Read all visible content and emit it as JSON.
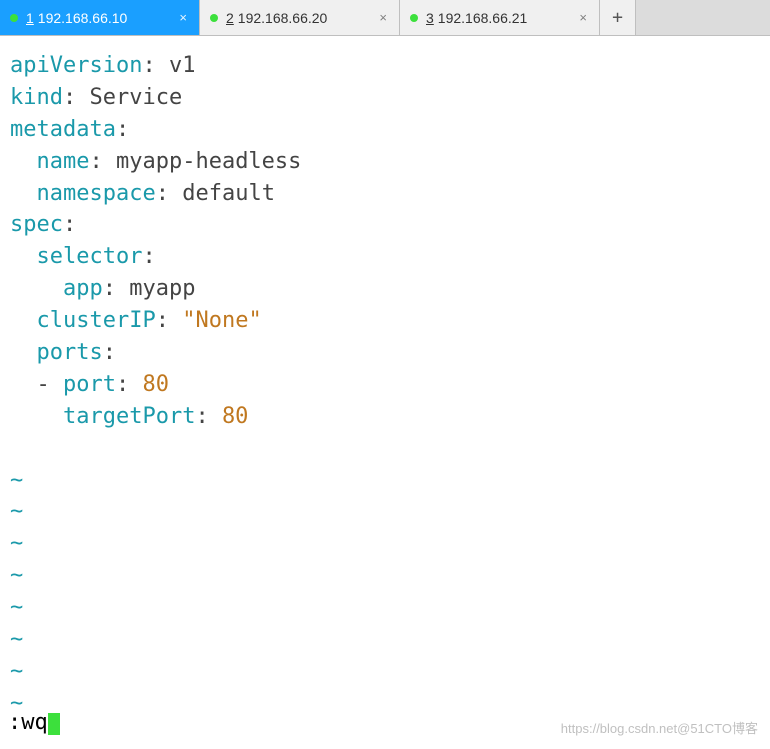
{
  "tabs": [
    {
      "index": "1",
      "label": "192.168.66.10",
      "active": true
    },
    {
      "index": "2",
      "label": "192.168.66.20",
      "active": false
    },
    {
      "index": "3",
      "label": "192.168.66.21",
      "active": false
    }
  ],
  "newtab_symbol": "+",
  "yaml": {
    "l1_key": "apiVersion",
    "l1_val": "v1",
    "l2_key": "kind",
    "l2_val": "Service",
    "l3_key": "metadata",
    "l4_key": "name",
    "l4_val": "myapp-headless",
    "l5_key": "namespace",
    "l5_val": "default",
    "l6_key": "spec",
    "l7_key": "selector",
    "l8_key": "app",
    "l8_val": "myapp",
    "l9_key": "clusterIP",
    "l9_val": "\"None\"",
    "l10_key": "ports",
    "l11_key": "port",
    "l11_val": "80",
    "l12_key": "targetPort",
    "l12_val": "80"
  },
  "tilde": "~",
  "command": ":wq",
  "watermark": "https://blog.csdn.net@51CTO博客"
}
